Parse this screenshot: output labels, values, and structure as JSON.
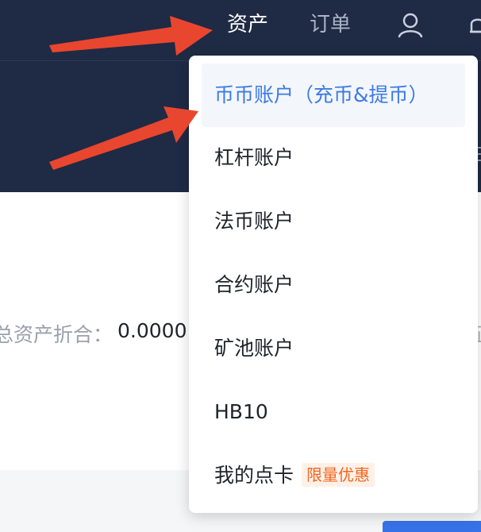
{
  "topbar": {
    "nav": {
      "assets": "资产",
      "orders": "订单"
    },
    "icons": {
      "user": "user-icon",
      "bell": "bell-icon"
    }
  },
  "summary": {
    "total_label": "总资产折合：",
    "total_value": "0.0000",
    "right_edge_char": "正"
  },
  "dropdown": {
    "items": [
      {
        "label": "币币账户（充币&提币）",
        "active": true
      },
      {
        "label": "杠杆账户"
      },
      {
        "label": "法币账户"
      },
      {
        "label": "合约账户"
      },
      {
        "label": "矿池账户"
      },
      {
        "label": "HB10"
      },
      {
        "label": "我的点卡",
        "badge": "限量优惠"
      }
    ]
  },
  "colors": {
    "header_bg": "#1f2a44",
    "active_text": "#3d7ae5",
    "badge_text": "#f0661e",
    "arrow": "#e8462f"
  }
}
